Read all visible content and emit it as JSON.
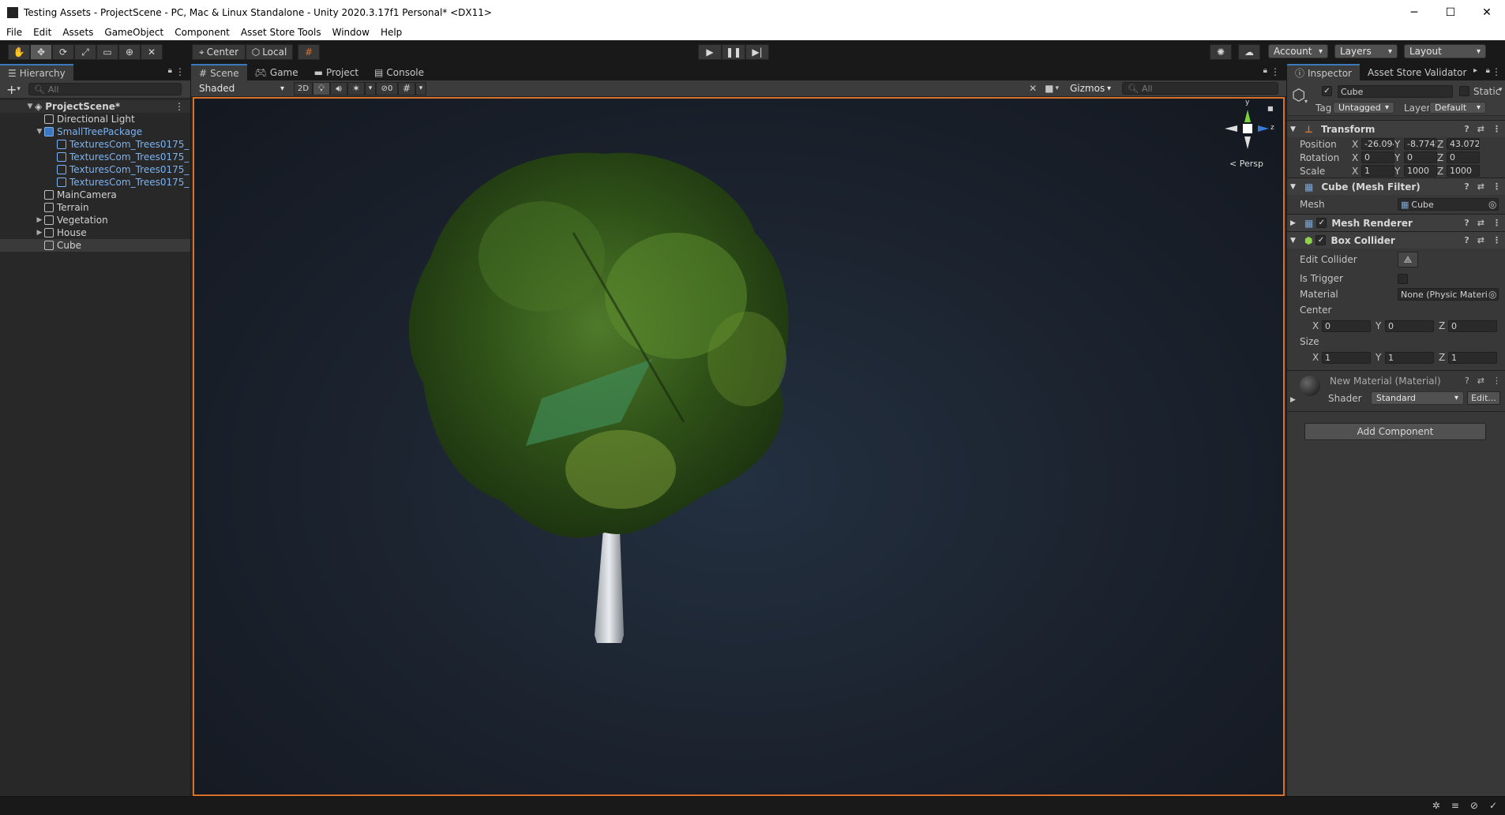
{
  "window": {
    "title": "Testing Assets - ProjectScene - PC, Mac & Linux Standalone - Unity 2020.3.17f1 Personal* <DX11>",
    "controls": [
      "─",
      "☐",
      "✕"
    ]
  },
  "menu": [
    "File",
    "Edit",
    "Assets",
    "GameObject",
    "Component",
    "Asset Store Tools",
    "Window",
    "Help"
  ],
  "toolbar": {
    "pivot": "Center",
    "space": "Local",
    "account": "Account",
    "layers": "Layers",
    "layout": "Layout"
  },
  "hierarchy": {
    "tab": "Hierarchy",
    "search_placeholder": "All",
    "scene": "ProjectScene*",
    "items": [
      {
        "label": "Directional Light",
        "depth": 1
      },
      {
        "label": "SmallTreePackage",
        "depth": 1,
        "expanded": true,
        "prefab": true
      },
      {
        "label": "TexturesCom_Trees0175_",
        "depth": 2,
        "prefab": true
      },
      {
        "label": "TexturesCom_Trees0175_",
        "depth": 2,
        "prefab": true
      },
      {
        "label": "TexturesCom_Trees0175_",
        "depth": 2,
        "prefab": true
      },
      {
        "label": "TexturesCom_Trees0175_",
        "depth": 2,
        "prefab": true
      },
      {
        "label": "MainCamera",
        "depth": 1
      },
      {
        "label": "Terrain",
        "depth": 1
      },
      {
        "label": "Vegetation",
        "depth": 1,
        "collapsed": true
      },
      {
        "label": "House",
        "depth": 1,
        "collapsed": true
      },
      {
        "label": "Cube",
        "depth": 1,
        "selected": true
      }
    ]
  },
  "center_tabs": [
    "Scene",
    "Game",
    "Project",
    "Console"
  ],
  "scene": {
    "shading": "Shaded",
    "mode_2d": "2D",
    "hidden_count": "0",
    "gizmos": "Gizmos",
    "search_placeholder": "All",
    "persp": "Persp",
    "axis_y": "y",
    "axis_z": "z"
  },
  "inspector": {
    "tabs": [
      "Inspector",
      "Asset Store Validator"
    ],
    "object_name": "Cube",
    "static": "Static",
    "tag_label": "Tag",
    "tag": "Untagged",
    "layer_label": "Layer",
    "layer": "Default",
    "transform": {
      "header": "Transform",
      "position_label": "Position",
      "rotation_label": "Rotation",
      "scale_label": "Scale",
      "position": [
        "-26.094",
        "-8.7745",
        "43.072"
      ],
      "rotation": [
        "0",
        "0",
        "0"
      ],
      "scale": [
        "1",
        "1000",
        "1000"
      ]
    },
    "mesh_filter": {
      "header": "Cube (Mesh Filter)",
      "mesh_label": "Mesh",
      "mesh": "Cube"
    },
    "mesh_renderer": {
      "header": "Mesh Renderer"
    },
    "box_collider": {
      "header": "Box Collider",
      "edit_label": "Edit Collider",
      "trigger_label": "Is Trigger",
      "material_label": "Material",
      "material": "None (Physic Materi",
      "center_label": "Center",
      "center": [
        "0",
        "0",
        "0"
      ],
      "size_label": "Size",
      "size": [
        "1",
        "1",
        "1"
      ]
    },
    "material": {
      "name": "New Material (Material)",
      "shader_label": "Shader",
      "shader": "Standard",
      "edit": "Edit..."
    },
    "add_component": "Add Component"
  },
  "colors": {
    "accent": "#3a79bb",
    "selection_border": "#d8722a",
    "prefab": "#7bb2f2"
  }
}
